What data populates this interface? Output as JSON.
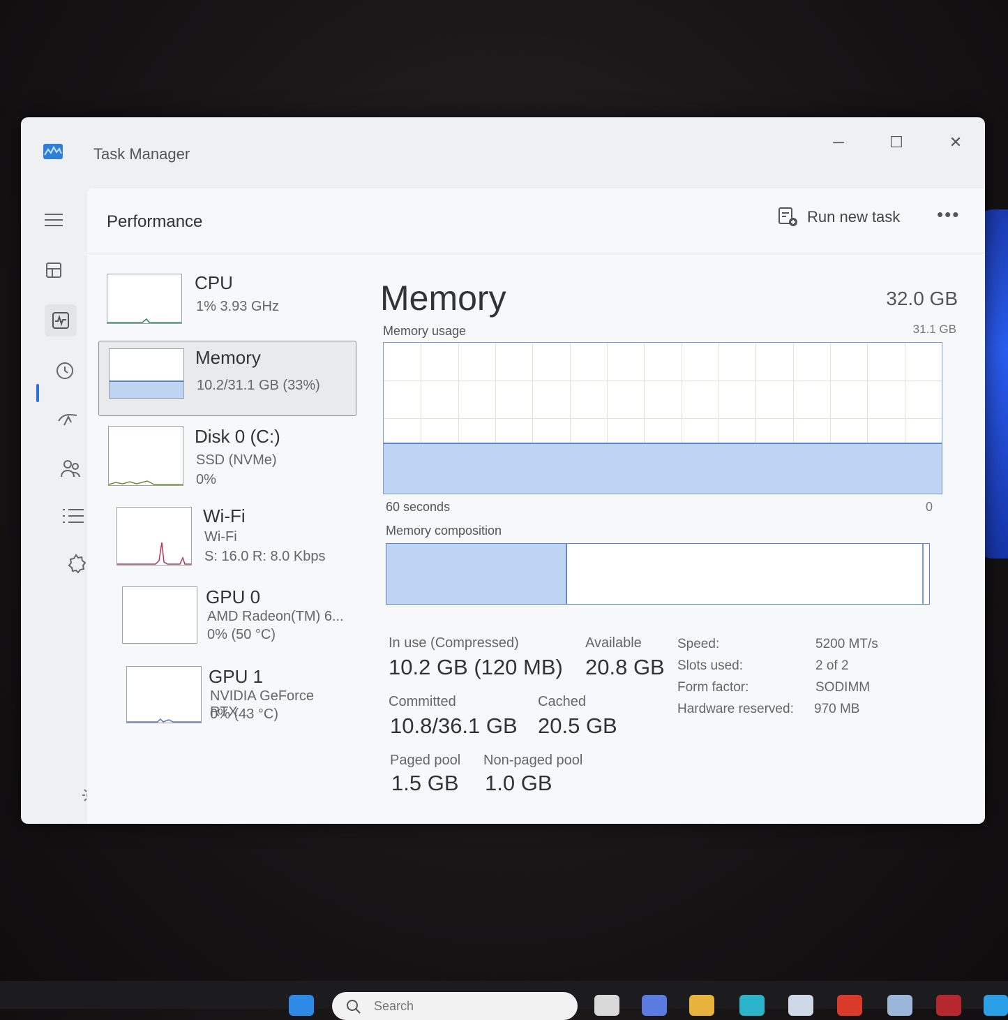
{
  "window": {
    "title": "Task Manager",
    "controls": {
      "minimize": "─",
      "maximize": "☐",
      "close": "✕"
    }
  },
  "header": {
    "page_title": "Performance",
    "run_new_task": "Run new task",
    "more": "•••"
  },
  "devices": [
    {
      "name": "CPU",
      "line1": "1%  3.93 GHz",
      "line2": ""
    },
    {
      "name": "Memory",
      "line1": "10.2/31.1 GB (33%)",
      "line2": ""
    },
    {
      "name": "Disk 0 (C:)",
      "line1": "SSD (NVMe)",
      "line2": "0%"
    },
    {
      "name": "Wi-Fi",
      "line1": "Wi-Fi",
      "line2": "S: 16.0  R: 8.0 Kbps"
    },
    {
      "name": "GPU 0",
      "line1": "AMD Radeon(TM) 6...",
      "line2": "0%  (50 °C)"
    },
    {
      "name": "GPU 1",
      "line1": "NVIDIA GeForce RTX...",
      "line2": "0%  (43 °C)"
    }
  ],
  "memory": {
    "title": "Memory",
    "total": "32.0 GB",
    "usage_label": "Memory usage",
    "usage_max": "31.1 GB",
    "time_left": "60 seconds",
    "time_right": "0",
    "usage_fraction": 0.33,
    "composition_label": "Memory composition",
    "composition_inuse_fraction": 0.33,
    "stats": {
      "in_use_label": "In use (Compressed)",
      "in_use_value": "10.2 GB (120 MB)",
      "available_label": "Available",
      "available_value": "20.8 GB",
      "committed_label": "Committed",
      "committed_value": "10.8/36.1 GB",
      "cached_label": "Cached",
      "cached_value": "20.5 GB",
      "paged_label": "Paged pool",
      "paged_value": "1.5 GB",
      "nonpaged_label": "Non-paged pool",
      "nonpaged_value": "1.0 GB"
    },
    "specs": {
      "speed_label": "Speed:",
      "speed_value": "5200 MT/s",
      "slots_label": "Slots used:",
      "slots_value": "2 of 2",
      "form_label": "Form factor:",
      "form_value": "SODIMM",
      "hw_label": "Hardware reserved:",
      "hw_value": "970 MB"
    }
  },
  "taskbar": {
    "search_placeholder": "Search"
  },
  "colors": {
    "accent": "#2a6fdb",
    "graph_fill": "#bfd3f2",
    "graph_line": "#5b86d3"
  }
}
